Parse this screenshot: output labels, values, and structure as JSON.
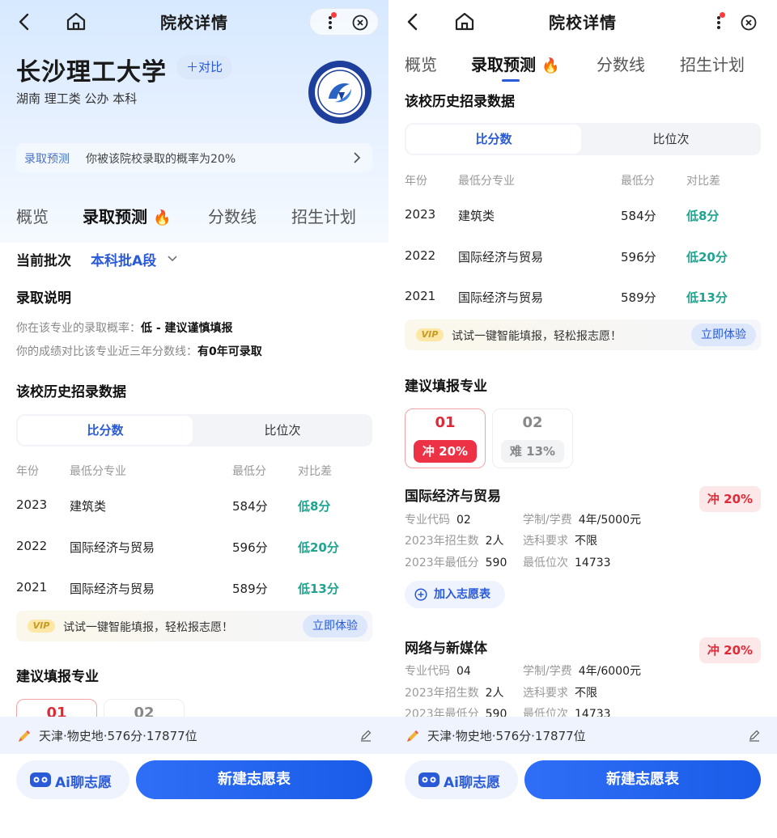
{
  "nav": {
    "title": "院校详情"
  },
  "school": {
    "name": "长沙理工大学",
    "compare_label": "＋对比",
    "tags": "湖南 理工类 公办 本科"
  },
  "predict": {
    "label": "录取预测",
    "text": "你被该院校录取的概率为20%"
  },
  "tabs": [
    {
      "label": "概览"
    },
    {
      "label": "录取预测",
      "emoji": "🔥"
    },
    {
      "label": "分数线"
    },
    {
      "label": "招生计划"
    }
  ],
  "batch": {
    "label": "当前批次",
    "value": "本科批A段"
  },
  "admission_note": {
    "title": "录取说明",
    "line1_prefix": "你在该专业的录取概率：",
    "line1_value": "低 - 建议谨慎填报",
    "line2_prefix": "你的成绩对比该专业近三年分数线：",
    "line2_value": "有0年可录取"
  },
  "history": {
    "title": "该校历史招录数据",
    "toggle_on": "比分数",
    "toggle_off": "比位次",
    "headers": [
      "年份",
      "最低分专业",
      "最低分",
      "对比差"
    ],
    "rows": [
      {
        "year": "2023",
        "major": "建筑类",
        "score": "584分",
        "diff": "低8分"
      },
      {
        "year": "2022",
        "major": "国际经济与贸易",
        "score": "596分",
        "diff": "低20分"
      },
      {
        "year": "2021",
        "major": "国际经济与贸易",
        "score": "589分",
        "diff": "低13分"
      }
    ]
  },
  "vip": {
    "badge": "VIP",
    "text": "试试一键智能填报，轻松报志愿！",
    "button": "立即体验"
  },
  "suggest": {
    "title": "建议填报专业",
    "cards": [
      {
        "num": "01",
        "tag": "冲 20%"
      },
      {
        "num": "02",
        "tag": "难 13%"
      }
    ]
  },
  "majors": [
    {
      "name": "国际经济与贸易",
      "badge": "冲 20%",
      "code_label": "专业代码",
      "code": "02",
      "fee_label": "学制/学费",
      "fee": "4年/5000元",
      "enroll_label": "2023年招生数",
      "enroll": "2人",
      "req_label": "选科要求",
      "req": "不限",
      "min_label": "2023年最低分",
      "min": "590",
      "rank_label": "最低位次",
      "rank": "14733",
      "add_label": "加入志愿表"
    },
    {
      "name": "网络与新媒体",
      "badge": "冲 20%",
      "code_label": "专业代码",
      "code": "04",
      "fee_label": "学制/学费",
      "fee": "4年/6000元",
      "enroll_label": "2023年招生数",
      "enroll": "2人",
      "req_label": "选科要求",
      "req": "不限",
      "min_label": "2023年最低分",
      "min": "590",
      "rank_label": "最低位次",
      "rank": "14733"
    }
  ],
  "footer": {
    "info": "天津·物史地·576分·17877位",
    "ai_label": "Ai聊志愿",
    "new_label": "新建志愿表"
  },
  "colors": {
    "accent": "#2a5ad8",
    "rush": "#e02a38",
    "good": "#1fa58f"
  },
  "icons": [
    "back-arrow-icon",
    "home-icon",
    "more-icon",
    "close-circle-icon",
    "chevron-right-icon",
    "fire-icon",
    "chevron-down-icon",
    "plus-circle-icon",
    "pencil-icon",
    "edit-icon",
    "ai-face-icon"
  ]
}
